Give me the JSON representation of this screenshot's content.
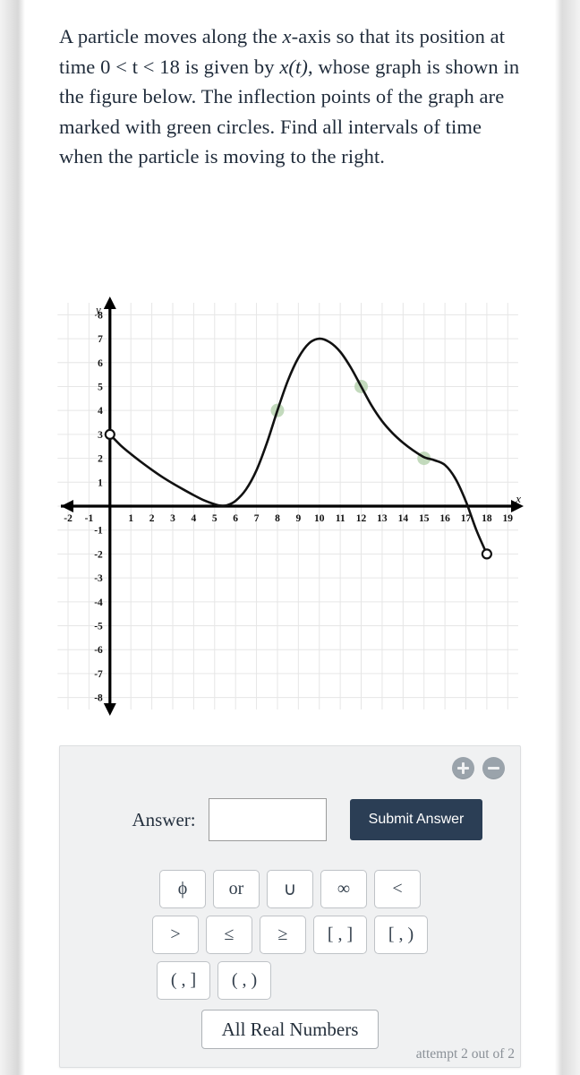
{
  "problem": {
    "line1_a": "A particle moves along the ",
    "line1_x": "x",
    "line1_b": "-axis so that its position at time ",
    "ineq": "0 < t < 18",
    "line1_c": " is given by ",
    "func": "x(t)",
    "line1_d": ", whose graph is shown in the figure below. The inflection points of the graph are marked with green circles. Find all intervals of time when the particle is moving to the right.",
    "full_text": "A particle moves along the x-axis so that its position at time 0 < t < 18 is given by x(t), whose graph is shown in the figure below. The inflection points of the graph are marked with green circles. Find all intervals of time when the particle is moving to the right."
  },
  "chart_data": {
    "type": "line",
    "title": "",
    "xlabel": "x",
    "ylabel": "y",
    "xlim": [
      -2.6,
      19.8
    ],
    "ylim": [
      -8.8,
      8.8
    ],
    "grid": true,
    "x_ticks": [
      -2,
      -1,
      1,
      2,
      3,
      4,
      5,
      6,
      7,
      8,
      9,
      10,
      11,
      12,
      13,
      14,
      15,
      16,
      17,
      18,
      19
    ],
    "y_ticks": [
      8,
      7,
      6,
      5,
      4,
      3,
      2,
      1,
      -1,
      -2,
      -3,
      -4,
      -5,
      -6,
      -7,
      -8
    ],
    "grid_x_range": [
      -2.5,
      19.5
    ],
    "grid_y_range": [
      -8.5,
      8.5
    ],
    "curve_color": "#111111",
    "grid_color": "#e6e6e6",
    "axis_color": "#000000",
    "inflection_color": "#b8d4b2",
    "series": [
      {
        "name": "x(t)",
        "points": [
          [
            0.0,
            3.0
          ],
          [
            0.5,
            2.55
          ],
          [
            1.0,
            2.18
          ],
          [
            1.5,
            1.84
          ],
          [
            2.0,
            1.52
          ],
          [
            2.5,
            1.22
          ],
          [
            3.0,
            0.95
          ],
          [
            3.5,
            0.7
          ],
          [
            4.0,
            0.46
          ],
          [
            4.5,
            0.24
          ],
          [
            5.0,
            0.08
          ],
          [
            5.3,
            0.02
          ],
          [
            5.6,
            0.04
          ],
          [
            6.0,
            0.22
          ],
          [
            6.5,
            0.7
          ],
          [
            7.0,
            1.5
          ],
          [
            7.5,
            2.65
          ],
          [
            8.0,
            4.0
          ],
          [
            8.5,
            5.25
          ],
          [
            9.0,
            6.2
          ],
          [
            9.5,
            6.8
          ],
          [
            10.0,
            7.0
          ],
          [
            10.5,
            6.85
          ],
          [
            11.0,
            6.45
          ],
          [
            11.5,
            5.8
          ],
          [
            12.0,
            5.0
          ],
          [
            12.5,
            4.2
          ],
          [
            13.0,
            3.55
          ],
          [
            13.5,
            3.05
          ],
          [
            14.0,
            2.65
          ],
          [
            14.5,
            2.32
          ],
          [
            15.0,
            2.05
          ],
          [
            15.5,
            1.92
          ],
          [
            16.0,
            1.72
          ],
          [
            16.5,
            1.15
          ],
          [
            17.0,
            0.2
          ],
          [
            17.5,
            -1.0
          ],
          [
            18.0,
            -2.0
          ]
        ]
      }
    ],
    "open_circles": [
      {
        "x": 0,
        "y": 3,
        "label": "start-open-point"
      },
      {
        "x": 18,
        "y": -2,
        "label": "end-open-point"
      }
    ],
    "inflection_points": [
      {
        "x": 8,
        "y": 4
      },
      {
        "x": 12,
        "y": 5
      },
      {
        "x": 15,
        "y": 2
      }
    ]
  },
  "answer_panel": {
    "zoom_in_label": "zoom-in",
    "zoom_out_label": "zoom-out",
    "answer_label": "Answer:",
    "answer_value": "",
    "answer_placeholder": "",
    "submit_label": "Submit Answer",
    "keypad_rows": [
      [
        "ϕ",
        "or",
        "∪",
        "∞",
        "<"
      ],
      [
        ">",
        "≤",
        "≥",
        "[ , ]",
        "[ , )"
      ],
      [
        "( , ]",
        "( , )"
      ]
    ],
    "all_real_label": "All Real Numbers",
    "attempt_text": "attempt 2 out of 2"
  },
  "colors": {
    "submit_bg": "#2b3e55",
    "panel_bg": "#f0f1f2",
    "text": "#1f2b3a",
    "inflection_green": "#b8d4b2"
  }
}
